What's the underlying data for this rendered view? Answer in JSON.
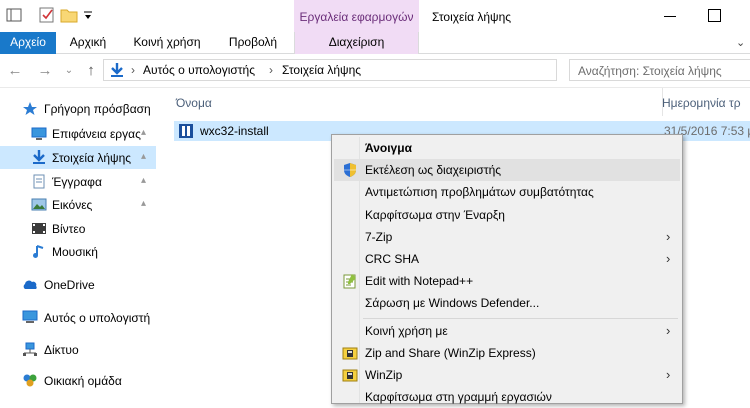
{
  "window": {
    "contextual_tab_group": "Εργαλεία εφαρμογών",
    "title": "Στοιχεία λήψης"
  },
  "ribbon": {
    "tabs": [
      "Αρχείο",
      "Αρχική",
      "Κοινή χρήση",
      "Προβολή",
      "Διαχείριση"
    ]
  },
  "address": {
    "segments": [
      "Αυτός ο υπολογιστής",
      "Στοιχεία λήψης"
    ],
    "search_placeholder": "Αναζήτηση: Στοιχεία λήψης"
  },
  "nav": {
    "quick_access": "Γρήγορη πρόσβαση",
    "items": [
      {
        "label": "Επιφάνεια εργας",
        "pinned": true
      },
      {
        "label": "Στοιχεία λήψης",
        "pinned": true,
        "selected": true
      },
      {
        "label": "Έγγραφα",
        "pinned": true
      },
      {
        "label": "Εικόνες",
        "pinned": true
      },
      {
        "label": "Βίντεο"
      },
      {
        "label": "Μουσική"
      }
    ],
    "onedrive": "OneDrive",
    "this_pc": "Αυτός ο υπολογιστή",
    "network": "Δίκτυο",
    "homegroup": "Οικιακή ομάδα"
  },
  "filelist": {
    "col_name": "Όνομα",
    "col_date": "Ημερομηνία τρ",
    "file": {
      "name": "wxc32-install",
      "date": "31/5/2016 7:53 μ"
    }
  },
  "context_menu": {
    "items": [
      {
        "label": "Άνοιγμα",
        "bold": true
      },
      {
        "label": "Εκτέλεση ως διαχειριστής",
        "icon": "shield-icon",
        "highlighted": true
      },
      {
        "label": "Αντιμετώπιση προβλημάτων συμβατότητας"
      },
      {
        "label": "Καρφίτσωμα στην Έναρξη"
      },
      {
        "label": "7-Zip",
        "submenu": true
      },
      {
        "label": "CRC SHA",
        "submenu": true
      },
      {
        "label": "Edit with Notepad++",
        "icon": "notepad-icon"
      },
      {
        "label": "Σάρωση με Windows Defender..."
      },
      {
        "label": "Κοινή χρήση με",
        "submenu": true
      },
      {
        "label": "Zip and Share (WinZip Express)",
        "icon": "winzip-icon"
      },
      {
        "label": "WinZip",
        "icon": "winzip-icon",
        "submenu": true
      },
      {
        "label": "Καρφίτσωμα στη γραμμή εργασιών"
      }
    ]
  },
  "colors": {
    "file_tab": "#1979ca",
    "contextual_tab": "#f1dcf5",
    "selection": "#cce8ff",
    "menu_bg": "#f0f0f0"
  }
}
